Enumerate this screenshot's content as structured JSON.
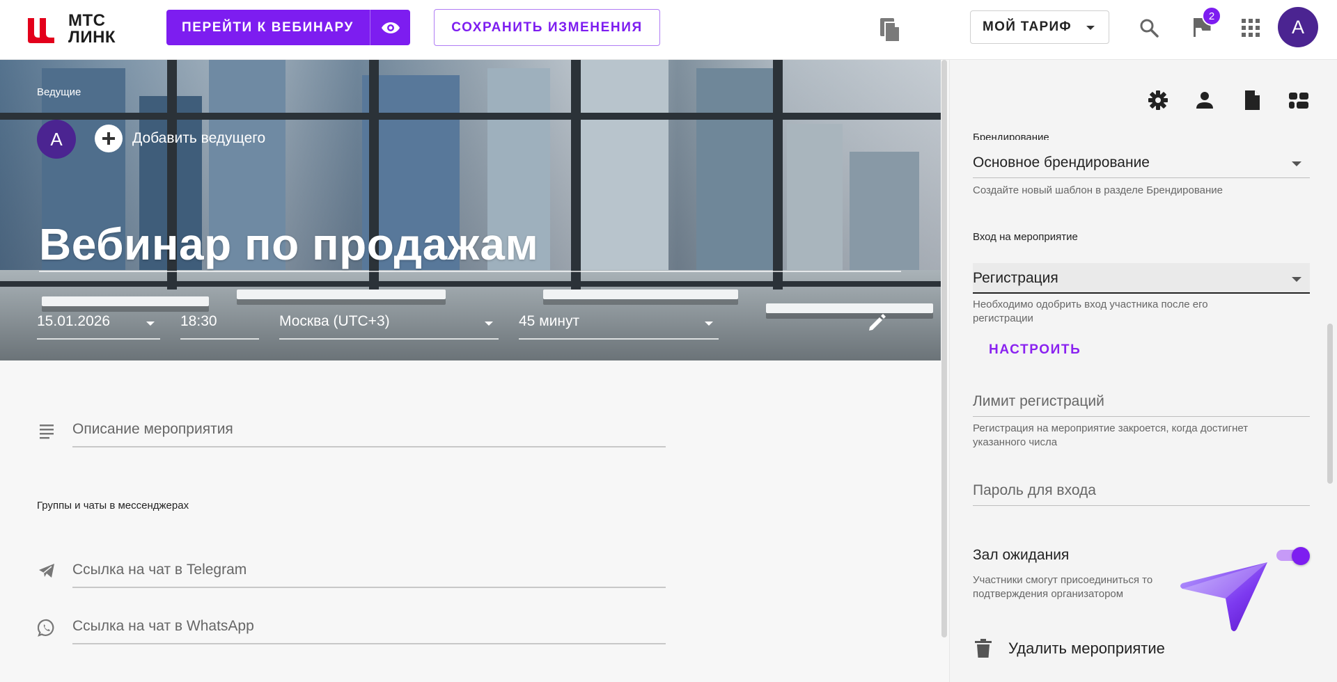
{
  "brand": {
    "line1": "МТС",
    "line2": "ЛИНК",
    "accent": "#7d1df0",
    "logo_red": "#e3001b"
  },
  "header": {
    "go_to_webinar": "ПЕРЕЙТИ К ВЕБИНАРУ",
    "save_changes": "СОХРАНИТЬ ИЗМЕНЕНИЯ",
    "tariff": "МОЙ ТАРИФ",
    "notifications_count": "2",
    "user_initial": "А"
  },
  "hero": {
    "hosts_label": "Ведущие",
    "host_initial": "А",
    "add_host": "Добавить ведущего",
    "title": "Вебинар по продажам",
    "date": "15.01.2026",
    "time": "18:30",
    "timezone": "Москва (UTC+3)",
    "duration": "45 минут"
  },
  "main": {
    "description_placeholder": "Описание мероприятия",
    "messengers_label": "Группы и чаты в мессенджерах",
    "telegram_placeholder": "Ссылка на чат в Telegram",
    "whatsapp_placeholder": "Ссылка на чат в WhatsApp"
  },
  "panel": {
    "branding_label": "Брендирование",
    "branding_value": "Основное брендирование",
    "branding_hint": "Создайте новый шаблон в разделе Брендирование",
    "entry_label": "Вход на мероприятие",
    "entry_value": "Регистрация",
    "entry_hint_1": "Необходимо одобрить вход участника после его",
    "entry_hint_2": "регистрации",
    "configure": "НАСТРОИТЬ",
    "reg_limit_placeholder": "Лимит регистраций",
    "reg_limit_hint_1": "Регистрация на мероприятие закроется, когда достигнет",
    "reg_limit_hint_2": "указанного числа",
    "password_placeholder": "Пароль для входа",
    "waiting_room_label": "Зал ожидания",
    "waiting_room_on": true,
    "waiting_room_hint_1": "Участники смогут присоединиться то",
    "waiting_room_hint_2": "подтверждения организатором",
    "delete_event": "Удалить мероприятие"
  },
  "icons": {
    "tabs": [
      "gear-icon",
      "person-icon",
      "document-icon",
      "layout-icon"
    ]
  }
}
